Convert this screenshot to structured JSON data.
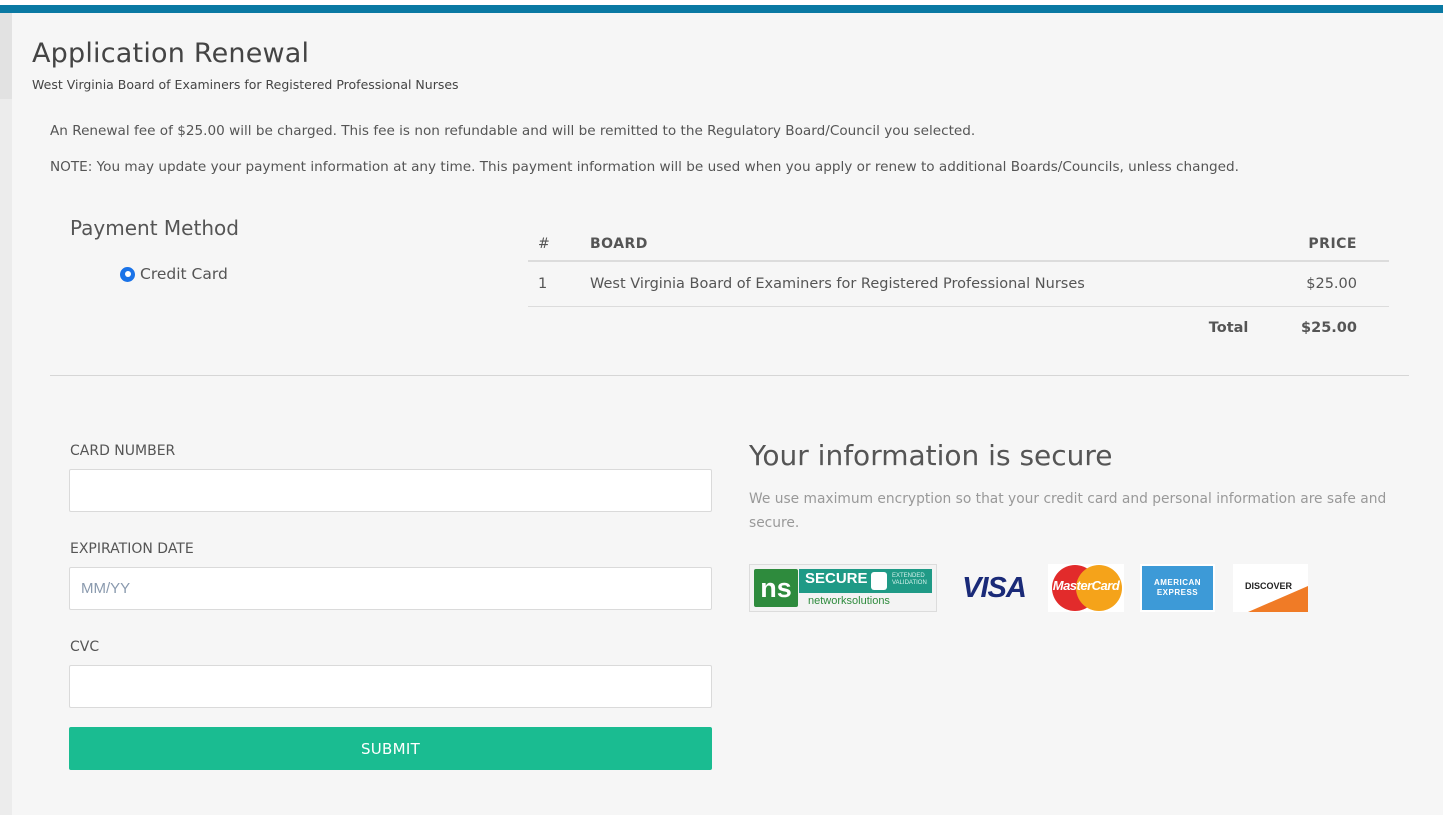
{
  "header": {
    "title": "Application Renewal",
    "subtitle": "West Virginia Board of Examiners for Registered Professional Nurses"
  },
  "notes": {
    "fee": "An Renewal fee of $25.00 will be charged. This fee is non refundable and will be remitted to the Regulatory Board/Council you selected.",
    "update": "NOTE: You may update your payment information at any time. This payment information will be used when you apply or renew to additional Boards/Councils, unless changed."
  },
  "payment_method": {
    "title": "Payment Method",
    "option_label": "Credit Card",
    "selected": true
  },
  "board_table": {
    "headers": {
      "num": "#",
      "board": "BOARD",
      "price": "PRICE"
    },
    "rows": [
      {
        "num": "1",
        "board": "West Virginia Board of Examiners for Registered Professional Nurses",
        "price": "$25.00"
      }
    ],
    "total_label": "Total",
    "total_value": "$25.00"
  },
  "form": {
    "card_number_label": "CARD NUMBER",
    "card_number_value": "",
    "expiration_label": "EXPIRATION DATE",
    "expiration_placeholder": "MM/YY",
    "cvc_label": "CVC",
    "cvc_value": "",
    "submit_label": "SUBMIT"
  },
  "security": {
    "title": "Your information is secure",
    "text": "We use maximum encryption so that your credit card and personal information are safe and secure.",
    "badges": {
      "ns_logo": "ns",
      "ns_secure": "SECURE",
      "ns_extended": "EXTENDED VALIDATION",
      "ns_footer": "networksolutions",
      "visa": "VISA",
      "mastercard": "MasterCard",
      "amex": "AMERICAN EXPRESS",
      "discover": "DISCOVER"
    }
  },
  "colors": {
    "accent_bar": "#0a79a3",
    "submit": "#1abc91",
    "radio": "#1a73e8"
  }
}
